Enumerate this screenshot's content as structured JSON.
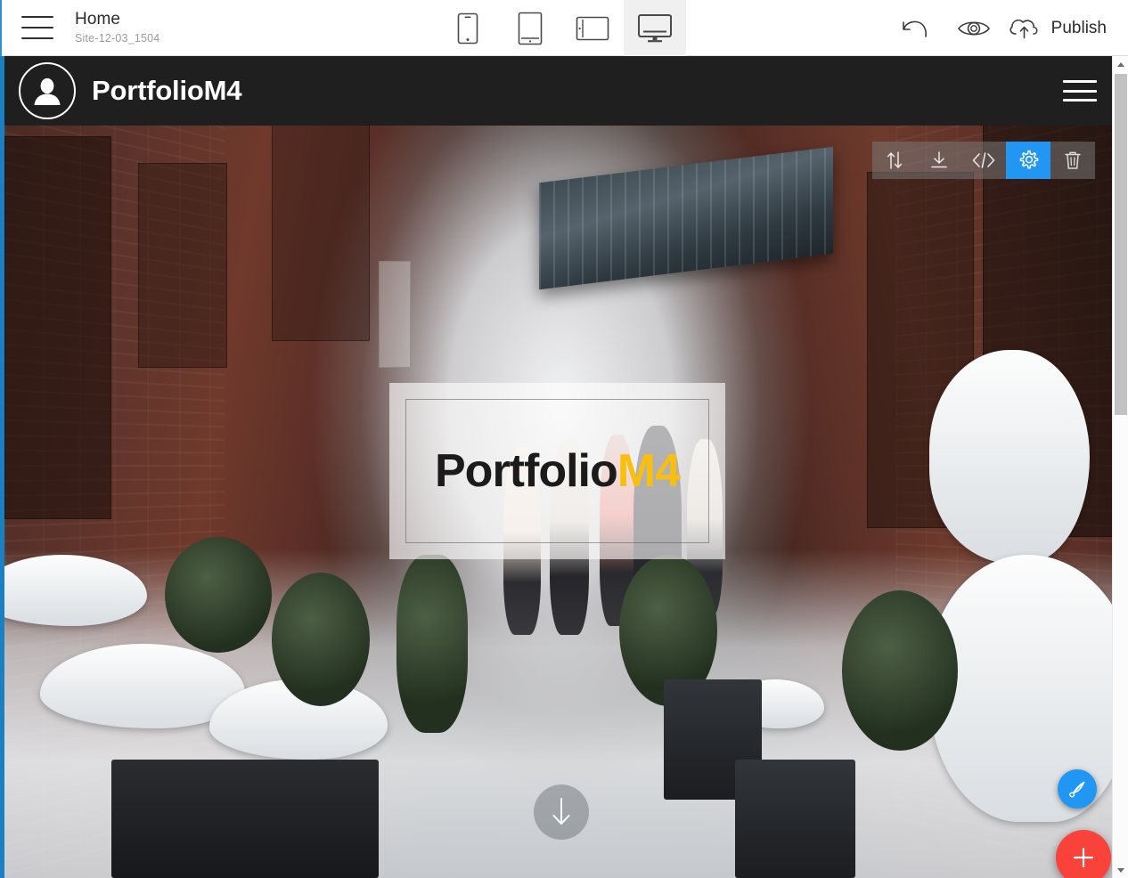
{
  "editor": {
    "menu_icon": "hamburger-menu-icon",
    "page_title": "Home",
    "project_id": "Site-12-03_1504",
    "devices": [
      {
        "name": "phone",
        "label": "Mobile preview",
        "selected": false
      },
      {
        "name": "tablet-portrait",
        "label": "Tablet portrait preview",
        "selected": false
      },
      {
        "name": "tablet-landscape",
        "label": "Tablet landscape preview",
        "selected": false
      },
      {
        "name": "desktop",
        "label": "Desktop preview",
        "selected": true
      }
    ],
    "actions": {
      "undo_icon": "undo-arrow-icon",
      "preview_icon": "eye-icon",
      "publish_icon": "cloud-upload-icon",
      "publish_label": "Publish"
    }
  },
  "block_toolbar": {
    "items": [
      {
        "name": "move-block",
        "icon": "up-down-arrows-icon",
        "active": false
      },
      {
        "name": "download-block",
        "icon": "download-icon",
        "active": false
      },
      {
        "name": "edit-code",
        "icon": "code-brackets-icon",
        "active": false
      },
      {
        "name": "block-settings",
        "icon": "gear-icon",
        "active": true
      },
      {
        "name": "delete-block",
        "icon": "trash-icon",
        "active": false
      }
    ],
    "active_color": "#2196f3"
  },
  "site": {
    "header": {
      "logo_icon": "user-avatar-icon",
      "brand_name": "PortfolioM4",
      "nav_toggle_icon": "hamburger-menu-icon"
    },
    "hero": {
      "title_primary": "Portfolio",
      "title_accent": "M4",
      "accent_color": "#f9bf10",
      "scroll_down_icon": "arrow-down-icon"
    }
  },
  "floating": {
    "style_button_icon": "paintbrush-icon",
    "style_button_color": "#2196f3",
    "add_block_icon": "plus-icon",
    "add_block_color": "#f9423a"
  },
  "scrollbar": {
    "up_icon": "triangle-up-icon",
    "down_icon": "triangle-down-icon"
  }
}
